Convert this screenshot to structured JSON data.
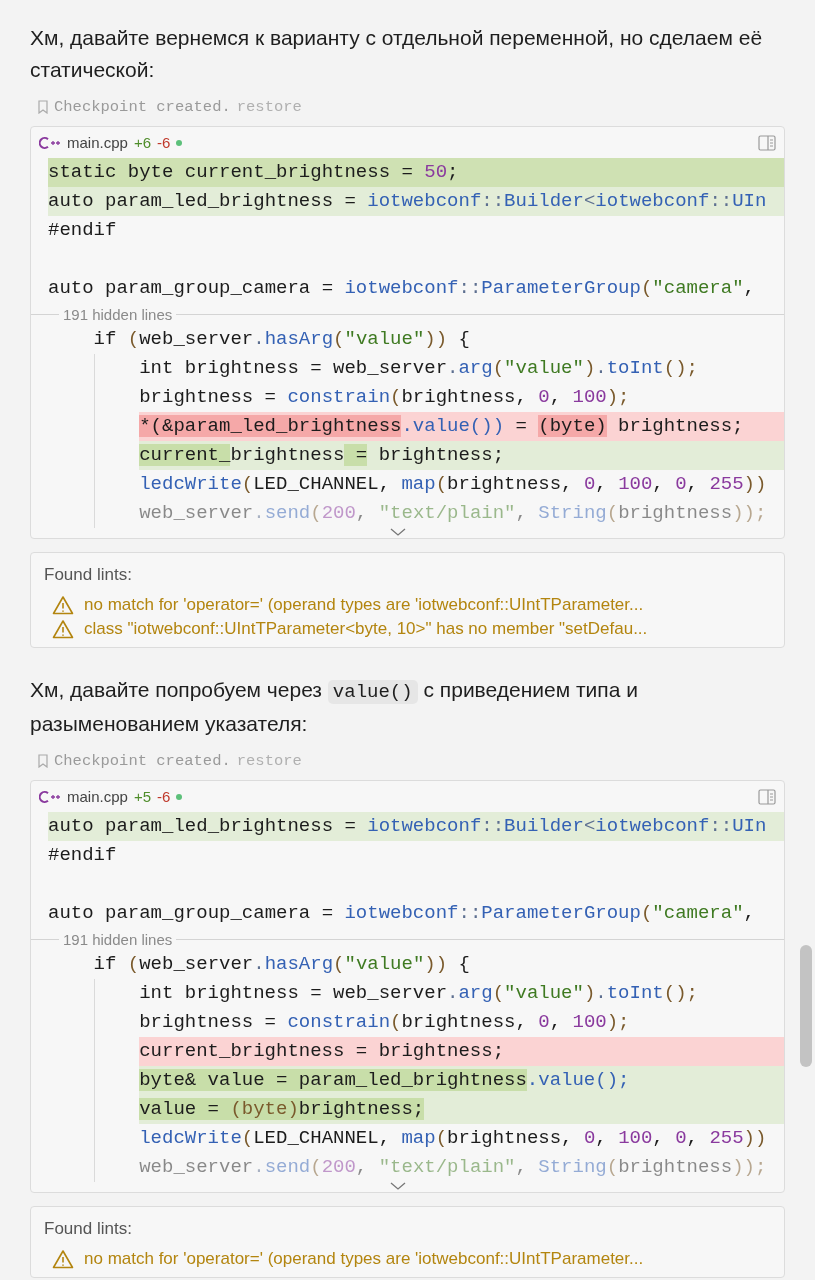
{
  "messages": [
    {
      "paragraph": [
        {
          "kind": "text",
          "text": "Хм, давайте вернемся к варианту с отдельной переменной, но сделаем её статической:"
        }
      ],
      "checkpoint": {
        "label": "Checkpoint created.",
        "action": "restore"
      },
      "diff": {
        "file": "main.cpp",
        "added": "+6",
        "removed": "-6",
        "unsaved": true,
        "lines": [
          {
            "kind": "inserted",
            "tokens": [
              {
                "t": "static byte current_brightness = ",
                "kind": "plain"
              },
              {
                "t": "50",
                "kind": "number"
              },
              {
                "t": ";",
                "kind": "plain"
              }
            ]
          },
          {
            "kind": "added",
            "tokens": [
              {
                "t": "auto param_led_brightness = ",
                "kind": "plain"
              },
              {
                "t": "iotwebconf",
                "kind": "function"
              },
              {
                "t": "::",
                "kind": "operator"
              },
              {
                "t": "Builder",
                "kind": "function"
              },
              {
                "t": "<",
                "kind": "operator"
              },
              {
                "t": "iotwebconf",
                "kind": "function"
              },
              {
                "t": "::",
                "kind": "operator"
              },
              {
                "t": "UIn",
                "kind": "function"
              }
            ]
          },
          {
            "kind": "context",
            "tokens": [
              {
                "t": "#endif",
                "kind": "plain"
              }
            ]
          },
          {
            "kind": "blank"
          },
          {
            "kind": "context",
            "tokens": [
              {
                "t": "auto param_group_camera = ",
                "kind": "plain"
              },
              {
                "t": "iotwebconf",
                "kind": "function"
              },
              {
                "t": "::",
                "kind": "operator"
              },
              {
                "t": "ParameterGroup",
                "kind": "function"
              },
              {
                "t": "(",
                "kind": "paren"
              },
              {
                "t": "\"camera\"",
                "kind": "string"
              },
              {
                "t": ",",
                "kind": "plain"
              }
            ]
          },
          {
            "kind": "hidden",
            "text": "191 hidden lines",
            "children": [
              {
                "kind": "context",
                "tokens": [
                  {
                    "t": "if ",
                    "kind": "plain"
                  },
                  {
                    "t": "(",
                    "kind": "paren"
                  },
                  {
                    "t": "web_server",
                    "kind": "plain"
                  },
                  {
                    "t": ".",
                    "kind": "operator"
                  },
                  {
                    "t": "hasArg",
                    "kind": "function"
                  },
                  {
                    "t": "(",
                    "kind": "paren"
                  },
                  {
                    "t": "\"value\"",
                    "kind": "string"
                  },
                  {
                    "t": "))",
                    "kind": "paren"
                  },
                  {
                    "t": " {",
                    "kind": "plain"
                  }
                ],
                "children": [
                  {
                    "kind": "context",
                    "tokens": [
                      {
                        "t": "int brightness = web_server",
                        "kind": "plain"
                      },
                      {
                        "t": ".",
                        "kind": "operator"
                      },
                      {
                        "t": "arg",
                        "kind": "function"
                      },
                      {
                        "t": "(",
                        "kind": "paren"
                      },
                      {
                        "t": "\"value\"",
                        "kind": "string"
                      },
                      {
                        "t": ")",
                        "kind": "paren"
                      },
                      {
                        "t": ".",
                        "kind": "operator"
                      },
                      {
                        "t": "toInt",
                        "kind": "function"
                      },
                      {
                        "t": "();",
                        "kind": "paren"
                      }
                    ]
                  },
                  {
                    "kind": "context",
                    "tokens": [
                      {
                        "t": "brightness = ",
                        "kind": "plain"
                      },
                      {
                        "t": "constrain",
                        "kind": "function"
                      },
                      {
                        "t": "(",
                        "kind": "paren"
                      },
                      {
                        "t": "brightness, ",
                        "kind": "plain"
                      },
                      {
                        "t": "0",
                        "kind": "number"
                      },
                      {
                        "t": ", ",
                        "kind": "plain"
                      },
                      {
                        "t": "100",
                        "kind": "number"
                      },
                      {
                        "t": ");",
                        "kind": "paren"
                      }
                    ]
                  },
                  {
                    "kind": "removed",
                    "tokens": [
                      {
                        "t": "*(&param_led_brightness",
                        "kind": "plain",
                        "highlighted": true
                      },
                      {
                        "t": ".value())",
                        "kind": "function",
                        "highlighted": false
                      },
                      {
                        "t": " = ",
                        "kind": "plain",
                        "highlighted": false
                      },
                      {
                        "t": "(byte)",
                        "kind": "plain",
                        "highlighted": true
                      },
                      {
                        "t": " brightness;",
                        "kind": "plain",
                        "highlighted": false
                      }
                    ]
                  },
                  {
                    "kind": "added",
                    "tokens": [
                      {
                        "t": "current_",
                        "kind": "plain",
                        "highlighted": true
                      },
                      {
                        "t": "brightness",
                        "kind": "plain",
                        "highlighted": false
                      },
                      {
                        "t": " =",
                        "kind": "plain",
                        "highlighted": true
                      },
                      {
                        "t": " brightness;",
                        "kind": "plain",
                        "highlighted": false
                      }
                    ]
                  },
                  {
                    "kind": "context",
                    "tokens": [
                      {
                        "t": "ledcWrite",
                        "kind": "function"
                      },
                      {
                        "t": "(",
                        "kind": "paren"
                      },
                      {
                        "t": "LED_CHANNEL, ",
                        "kind": "plain"
                      },
                      {
                        "t": "map",
                        "kind": "function"
                      },
                      {
                        "t": "(",
                        "kind": "paren"
                      },
                      {
                        "t": "brightness, ",
                        "kind": "plain"
                      },
                      {
                        "t": "0",
                        "kind": "number"
                      },
                      {
                        "t": ", ",
                        "kind": "plain"
                      },
                      {
                        "t": "100",
                        "kind": "number"
                      },
                      {
                        "t": ", ",
                        "kind": "plain"
                      },
                      {
                        "t": "0",
                        "kind": "number"
                      },
                      {
                        "t": ", ",
                        "kind": "plain"
                      },
                      {
                        "t": "255",
                        "kind": "number"
                      },
                      {
                        "t": "))",
                        "kind": "paren"
                      }
                    ]
                  },
                  {
                    "kind": "context",
                    "faded": true,
                    "tokens": [
                      {
                        "t": "web_server",
                        "kind": "plain"
                      },
                      {
                        "t": ".",
                        "kind": "operator"
                      },
                      {
                        "t": "send",
                        "kind": "function"
                      },
                      {
                        "t": "(",
                        "kind": "paren"
                      },
                      {
                        "t": "200",
                        "kind": "number"
                      },
                      {
                        "t": ", ",
                        "kind": "plain"
                      },
                      {
                        "t": "\"text/plain\"",
                        "kind": "string"
                      },
                      {
                        "t": ", ",
                        "kind": "plain"
                      },
                      {
                        "t": "String",
                        "kind": "function"
                      },
                      {
                        "t": "(",
                        "kind": "paren"
                      },
                      {
                        "t": "brightness",
                        "kind": "plain"
                      },
                      {
                        "t": "));",
                        "kind": "paren"
                      }
                    ]
                  }
                ]
              }
            ]
          }
        ]
      },
      "lints": {
        "title": "Found lints:",
        "items": [
          "no match for 'operator=' (operand types are 'iotwebconf::UIntTParameter...",
          "class \"iotwebconf::UIntTParameter<byte, 10>\" has no member \"setDefau..."
        ]
      }
    },
    {
      "paragraph": [
        {
          "kind": "text",
          "text": "Хм, давайте попробуем через "
        },
        {
          "kind": "code",
          "text": "value()"
        },
        {
          "kind": "text",
          "text": " с приведением типа и разыменованием указателя:"
        }
      ],
      "checkpoint": {
        "label": "Checkpoint created.",
        "action": "restore"
      },
      "diff": {
        "file": "main.cpp",
        "added": "+5",
        "removed": "-6",
        "unsaved": true,
        "lines": [
          {
            "kind": "added",
            "tokens": [
              {
                "t": "auto param_led_brightness = ",
                "kind": "plain"
              },
              {
                "t": "iotwebconf",
                "kind": "function"
              },
              {
                "t": "::",
                "kind": "operator"
              },
              {
                "t": "Builder",
                "kind": "function"
              },
              {
                "t": "<",
                "kind": "operator"
              },
              {
                "t": "iotwebconf",
                "kind": "function"
              },
              {
                "t": "::",
                "kind": "operator"
              },
              {
                "t": "UIn",
                "kind": "function"
              }
            ]
          },
          {
            "kind": "context",
            "tokens": [
              {
                "t": "#endif",
                "kind": "plain"
              }
            ]
          },
          {
            "kind": "blank"
          },
          {
            "kind": "context",
            "tokens": [
              {
                "t": "auto param_group_camera = ",
                "kind": "plain"
              },
              {
                "t": "iotwebconf",
                "kind": "function"
              },
              {
                "t": "::",
                "kind": "operator"
              },
              {
                "t": "ParameterGroup",
                "kind": "function"
              },
              {
                "t": "(",
                "kind": "paren"
              },
              {
                "t": "\"camera\"",
                "kind": "string"
              },
              {
                "t": ",",
                "kind": "plain"
              }
            ]
          },
          {
            "kind": "hidden",
            "text": "191 hidden lines",
            "children": [
              {
                "kind": "context",
                "tokens": [
                  {
                    "t": "if ",
                    "kind": "plain"
                  },
                  {
                    "t": "(",
                    "kind": "paren"
                  },
                  {
                    "t": "web_server",
                    "kind": "plain"
                  },
                  {
                    "t": ".",
                    "kind": "operator"
                  },
                  {
                    "t": "hasArg",
                    "kind": "function"
                  },
                  {
                    "t": "(",
                    "kind": "paren"
                  },
                  {
                    "t": "\"value\"",
                    "kind": "string"
                  },
                  {
                    "t": "))",
                    "kind": "paren"
                  },
                  {
                    "t": " {",
                    "kind": "plain"
                  }
                ],
                "children": [
                  {
                    "kind": "context",
                    "tokens": [
                      {
                        "t": "int brightness = web_server",
                        "kind": "plain"
                      },
                      {
                        "t": ".",
                        "kind": "operator"
                      },
                      {
                        "t": "arg",
                        "kind": "function"
                      },
                      {
                        "t": "(",
                        "kind": "paren"
                      },
                      {
                        "t": "\"value\"",
                        "kind": "string"
                      },
                      {
                        "t": ")",
                        "kind": "paren"
                      },
                      {
                        "t": ".",
                        "kind": "operator"
                      },
                      {
                        "t": "toInt",
                        "kind": "function"
                      },
                      {
                        "t": "();",
                        "kind": "paren"
                      }
                    ]
                  },
                  {
                    "kind": "context",
                    "tokens": [
                      {
                        "t": "brightness = ",
                        "kind": "plain"
                      },
                      {
                        "t": "constrain",
                        "kind": "function"
                      },
                      {
                        "t": "(",
                        "kind": "paren"
                      },
                      {
                        "t": "brightness, ",
                        "kind": "plain"
                      },
                      {
                        "t": "0",
                        "kind": "number"
                      },
                      {
                        "t": ", ",
                        "kind": "plain"
                      },
                      {
                        "t": "100",
                        "kind": "number"
                      },
                      {
                        "t": ");",
                        "kind": "paren"
                      }
                    ]
                  },
                  {
                    "kind": "removed",
                    "tokens": [
                      {
                        "t": "current_brightness = brightness;",
                        "kind": "plain",
                        "highlighted": false
                      }
                    ]
                  },
                  {
                    "kind": "added",
                    "tokens": [
                      {
                        "t": "byte& value = param_led_brightness",
                        "kind": "plain",
                        "highlighted": true
                      },
                      {
                        "t": ".value();",
                        "kind": "function",
                        "highlighted": false
                      }
                    ]
                  },
                  {
                    "kind": "added",
                    "tokens": [
                      {
                        "t": "value = ",
                        "kind": "plain",
                        "highlighted": true
                      },
                      {
                        "t": "(byte)",
                        "kind": "paren",
                        "highlighted": true
                      },
                      {
                        "t": "brightness;",
                        "kind": "plain",
                        "highlighted": true
                      }
                    ]
                  },
                  {
                    "kind": "context",
                    "tokens": [
                      {
                        "t": "ledcWrite",
                        "kind": "function"
                      },
                      {
                        "t": "(",
                        "kind": "paren"
                      },
                      {
                        "t": "LED_CHANNEL, ",
                        "kind": "plain"
                      },
                      {
                        "t": "map",
                        "kind": "function"
                      },
                      {
                        "t": "(",
                        "kind": "paren"
                      },
                      {
                        "t": "brightness, ",
                        "kind": "plain"
                      },
                      {
                        "t": "0",
                        "kind": "number"
                      },
                      {
                        "t": ", ",
                        "kind": "plain"
                      },
                      {
                        "t": "100",
                        "kind": "number"
                      },
                      {
                        "t": ", ",
                        "kind": "plain"
                      },
                      {
                        "t": "0",
                        "kind": "number"
                      },
                      {
                        "t": ", ",
                        "kind": "plain"
                      },
                      {
                        "t": "255",
                        "kind": "number"
                      },
                      {
                        "t": "))",
                        "kind": "paren"
                      }
                    ]
                  },
                  {
                    "kind": "context",
                    "faded": true,
                    "tokens": [
                      {
                        "t": "web_server",
                        "kind": "plain"
                      },
                      {
                        "t": ".",
                        "kind": "operator"
                      },
                      {
                        "t": "send",
                        "kind": "function"
                      },
                      {
                        "t": "(",
                        "kind": "paren"
                      },
                      {
                        "t": "200",
                        "kind": "number"
                      },
                      {
                        "t": ", ",
                        "kind": "plain"
                      },
                      {
                        "t": "\"text/plain\"",
                        "kind": "string"
                      },
                      {
                        "t": ", ",
                        "kind": "plain"
                      },
                      {
                        "t": "String",
                        "kind": "function"
                      },
                      {
                        "t": "(",
                        "kind": "paren"
                      },
                      {
                        "t": "brightness",
                        "kind": "plain"
                      },
                      {
                        "t": "));",
                        "kind": "paren"
                      }
                    ]
                  }
                ]
              }
            ]
          }
        ]
      },
      "lints": {
        "title": "Found lints:",
        "items": [
          "no match for 'operator=' (operand types are 'iotwebconf::UIntTParameter..."
        ]
      }
    }
  ]
}
